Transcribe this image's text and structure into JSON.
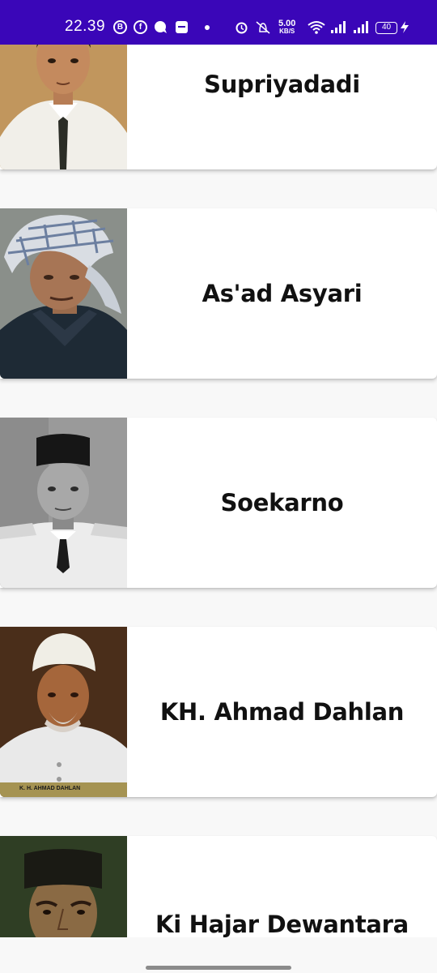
{
  "status_bar": {
    "time": "22.39",
    "net_speed_value": "5.00",
    "net_speed_unit": "KB/S",
    "battery": "40",
    "background": "#3a06b8"
  },
  "heroes": [
    {
      "name": "Supriyadadi"
    },
    {
      "name": "As'ad Asyari"
    },
    {
      "name": "Soekarno"
    },
    {
      "name": "KH. Ahmad Dahlan",
      "photo_caption": "K. H. AHMAD DAHLAN"
    },
    {
      "name": "Ki Hajar Dewantara"
    }
  ]
}
